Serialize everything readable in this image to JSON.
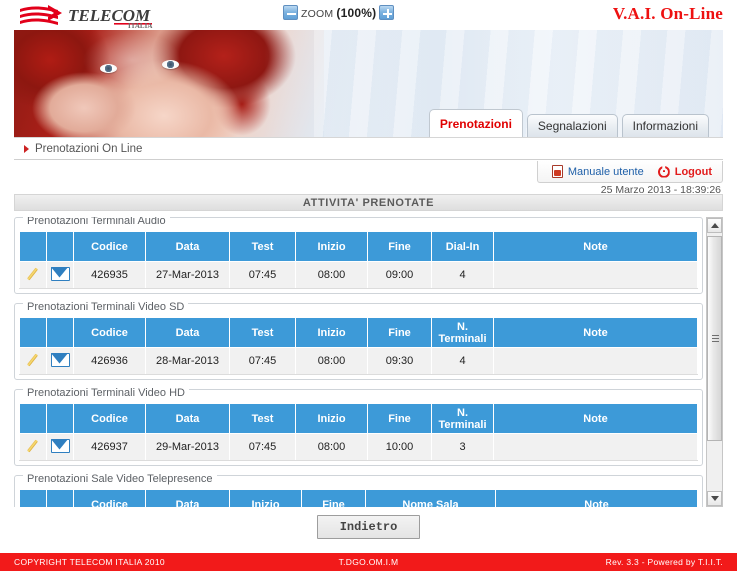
{
  "header": {
    "logo_text": "TELECOM",
    "logo_sub": "ITALIA",
    "zoom_label": "ZOOM",
    "zoom_value": "(100%)",
    "zoom_out_icon": "minus-icon",
    "zoom_in_icon": "plus-icon",
    "app_title": "V.A.I. On-Line"
  },
  "tabs": [
    {
      "label": "Prenotazioni",
      "active": true
    },
    {
      "label": "Segnalazioni",
      "active": false
    },
    {
      "label": "Informazioni",
      "active": false
    }
  ],
  "breadcrumb": {
    "text": "Prenotazioni On Line"
  },
  "utility": {
    "manual_label": "Manuale utente",
    "manual_icon": "pdf-icon",
    "logout_label": "Logout",
    "logout_icon": "power-icon",
    "datetime": "25 Marzo 2013 - 18:39:26"
  },
  "content": {
    "section_title": "ATTIVITA' PRENOTATE",
    "sections": [
      {
        "legend": "Prenotazioni Terminali Audio",
        "columns": [
          "",
          "",
          "Codice",
          "Data",
          "Test",
          "Inizio",
          "Fine",
          "Dial-In",
          "Note"
        ],
        "rows": [
          {
            "edit_icon": "pencil-icon",
            "mail_icon": "envelope-icon",
            "cells": [
              "426935",
              "27-Mar-2013",
              "07:45",
              "08:00",
              "09:00",
              "4",
              ""
            ]
          }
        ]
      },
      {
        "legend": "Prenotazioni Terminali Video SD",
        "columns": [
          "",
          "",
          "Codice",
          "Data",
          "Test",
          "Inizio",
          "Fine",
          "N. Terminali",
          "Note"
        ],
        "rows": [
          {
            "edit_icon": "pencil-icon",
            "mail_icon": "envelope-icon",
            "cells": [
              "426936",
              "28-Mar-2013",
              "07:45",
              "08:00",
              "09:30",
              "4",
              ""
            ]
          }
        ]
      },
      {
        "legend": "Prenotazioni Terminali Video HD",
        "columns": [
          "",
          "",
          "Codice",
          "Data",
          "Test",
          "Inizio",
          "Fine",
          "N. Terminali",
          "Note"
        ],
        "rows": [
          {
            "edit_icon": "pencil-icon",
            "mail_icon": "envelope-icon",
            "cells": [
              "426937",
              "29-Mar-2013",
              "07:45",
              "08:00",
              "10:00",
              "3",
              ""
            ]
          }
        ]
      },
      {
        "legend": "Prenotazioni Sale Video Telepresence",
        "columns": [
          "",
          "",
          "Codice",
          "Data",
          "Inizio",
          "Fine",
          "Nome Sala",
          "Note"
        ],
        "rows": []
      }
    ]
  },
  "actions": {
    "back_label": "Indietro"
  },
  "footer": {
    "left": "COPYRIGHT TELECOM ITALIA 2010",
    "center": "T.DGO.OM.I.M",
    "right": "Rev. 3.3 - Powered by T.I.I.T."
  },
  "colors": {
    "brand_red": "#f21a1a",
    "table_header_blue": "#3d9ad8",
    "link_blue": "#1e5fa8"
  }
}
